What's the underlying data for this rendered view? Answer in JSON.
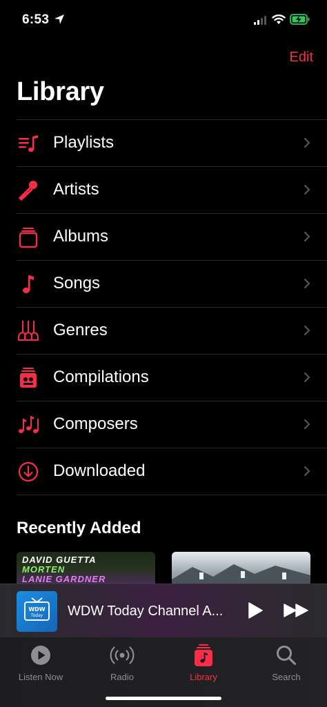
{
  "status_bar": {
    "time": "6:53"
  },
  "header": {
    "edit_label": "Edit",
    "title": "Library"
  },
  "library_items": [
    {
      "label": "Playlists",
      "icon": "playlist-icon"
    },
    {
      "label": "Artists",
      "icon": "microphone-icon"
    },
    {
      "label": "Albums",
      "icon": "album-stack-icon"
    },
    {
      "label": "Songs",
      "icon": "music-note-icon"
    },
    {
      "label": "Genres",
      "icon": "guitars-icon"
    },
    {
      "label": "Compilations",
      "icon": "compilation-icon"
    },
    {
      "label": "Composers",
      "icon": "composer-notes-icon"
    },
    {
      "label": "Downloaded",
      "icon": "download-circle-icon"
    }
  ],
  "recently_added": {
    "title": "Recently Added",
    "album1_text": [
      "DAVID GUETTA",
      "MORTEN",
      "LANIE GARDNER"
    ]
  },
  "mini_player": {
    "title": "WDW Today Channel A..."
  },
  "tabs": [
    {
      "label": "Listen Now",
      "active": false
    },
    {
      "label": "Radio",
      "active": false
    },
    {
      "label": "Library",
      "active": true
    },
    {
      "label": "Search",
      "active": false
    }
  ],
  "colors": {
    "accent": "#fa2d48",
    "inactive": "#8e8e93",
    "background": "#000000"
  }
}
